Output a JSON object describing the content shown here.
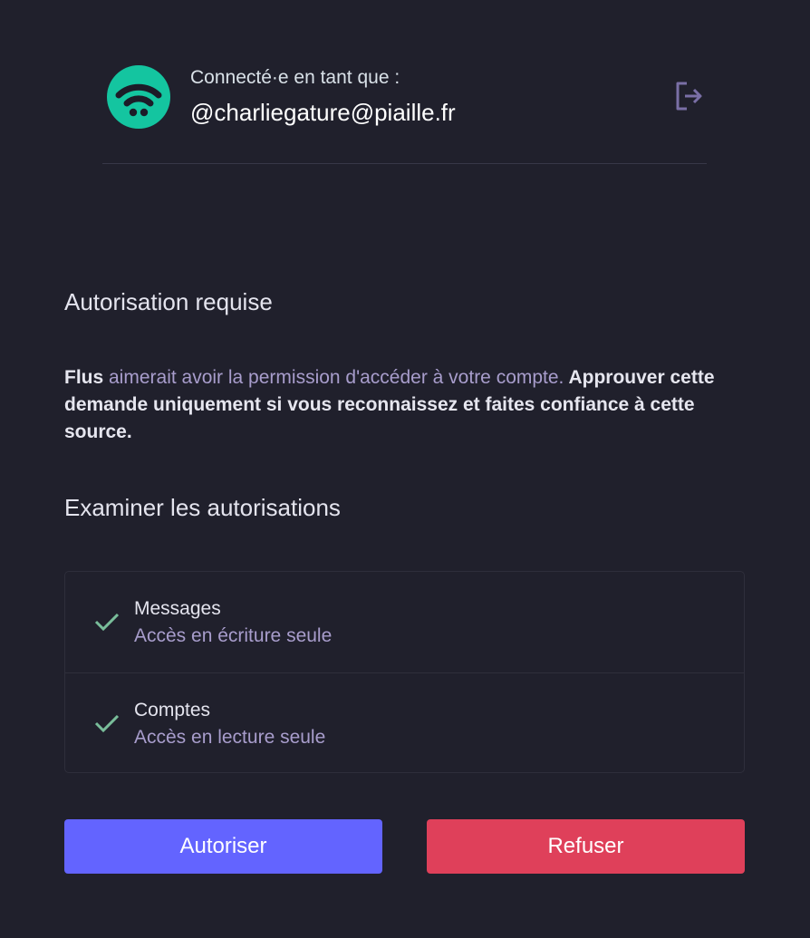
{
  "header": {
    "signed_in_label": "Connecté·e en tant que :",
    "account_handle": "@charliegature@piaille.fr",
    "avatar_icon": "wifi-logo-icon",
    "logout_icon": "logout-icon"
  },
  "authorization": {
    "title": "Autorisation requise",
    "app_name": "Flus",
    "request_text": " aimerait avoir la permission d'accéder à votre compte.",
    "warning_text": " Approuver cette demande uniquement si vous reconnaissez et faites confiance à cette source."
  },
  "review": {
    "title": "Examiner les autorisations",
    "permissions": [
      {
        "name": "Messages",
        "description": "Accès en écriture seule",
        "icon": "check-icon"
      },
      {
        "name": "Comptes",
        "description": "Accès en lecture seule",
        "icon": "check-icon"
      }
    ]
  },
  "actions": {
    "authorize_label": "Autoriser",
    "deny_label": "Refuser"
  },
  "colors": {
    "background": "#20202c",
    "brand": "#14c5a0",
    "accent": "#6364ff",
    "danger": "#df405a",
    "muted_text": "#a89dcc",
    "check": "#79bd9a"
  }
}
